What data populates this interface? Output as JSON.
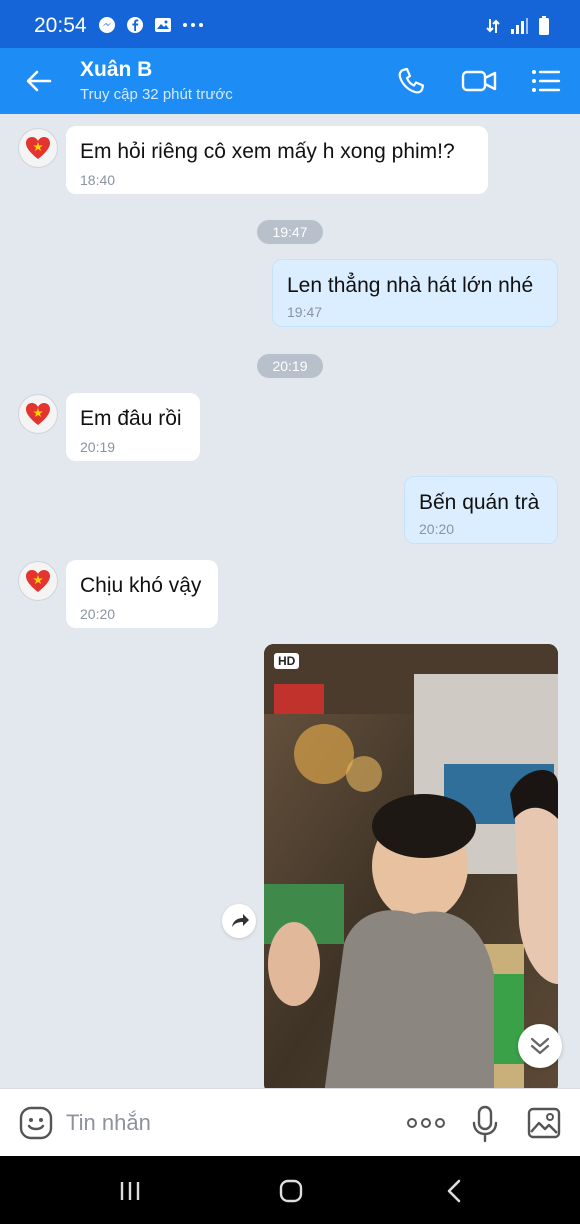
{
  "status_bar": {
    "time": "20:54",
    "icons": [
      "messenger-icon",
      "facebook-icon",
      "gallery-icon",
      "more-dots-icon"
    ],
    "right_icons": [
      "mobile-data-icon",
      "signal-icon",
      "battery-icon"
    ]
  },
  "header": {
    "contact_name": "Xuân B",
    "last_seen": "Truy cập 32 phút trước",
    "icons": [
      "back-arrow-icon",
      "phone-call-icon",
      "video-call-icon",
      "menu-list-icon"
    ]
  },
  "messages": [
    {
      "direction": "incoming",
      "text": "Em hỏi riêng cô xem mấy h xong phim!?",
      "time": "18:40"
    },
    {
      "type": "divider",
      "text": "19:47"
    },
    {
      "direction": "outgoing",
      "text": "Len thẳng nhà hát lớn nhé",
      "time": "19:47"
    },
    {
      "type": "divider",
      "text": "20:19"
    },
    {
      "direction": "incoming",
      "text": "Em đâu rồi",
      "time": "20:19"
    },
    {
      "direction": "outgoing",
      "text": "Bến quán trà",
      "time": "20:20"
    },
    {
      "direction": "incoming",
      "text": "Chịu khó vậy",
      "time": "20:20"
    },
    {
      "type": "photo",
      "badge": "HD",
      "description_icon": "photo-thumbnail"
    }
  ],
  "composer": {
    "placeholder": "Tin nhắn",
    "icons": [
      "sticker-icon",
      "more-options-icon",
      "microphone-icon",
      "image-icon"
    ]
  },
  "colors": {
    "status_bar": "#1565d8",
    "header": "#1d8cf5",
    "chat_bg": "#e3e8ef",
    "incoming_bubble": "#ffffff",
    "outgoing_bubble": "#dbeeff"
  }
}
